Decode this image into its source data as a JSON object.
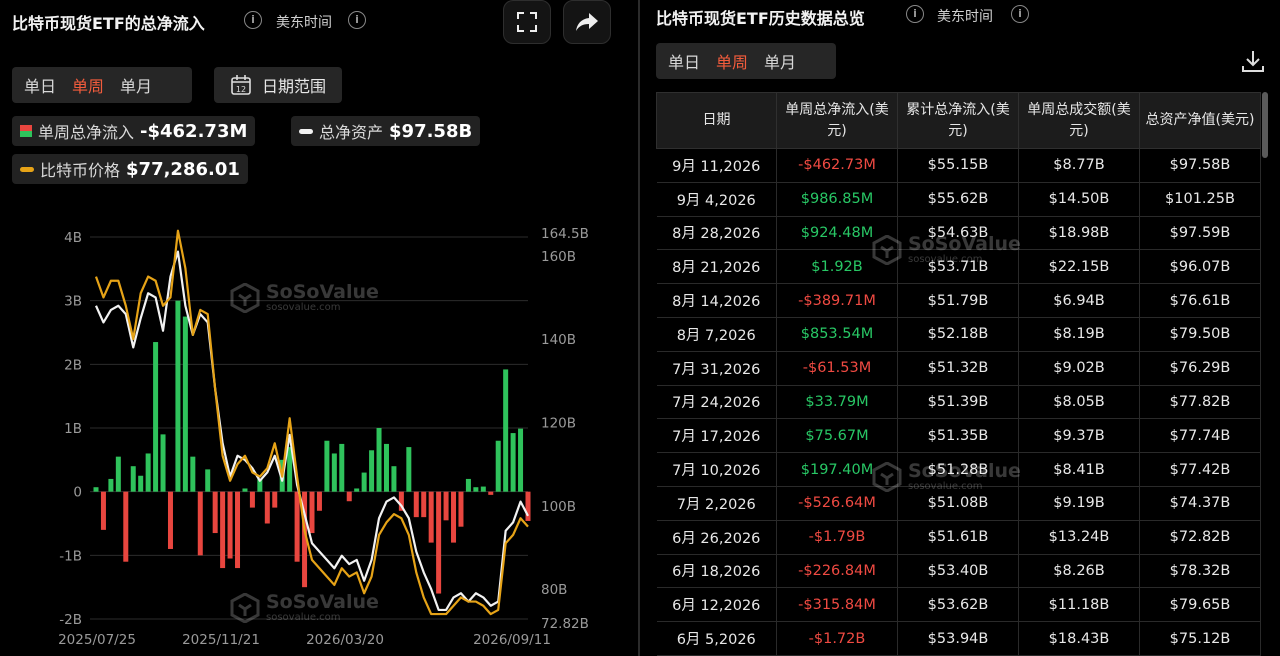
{
  "left": {
    "title": "比特币现货ETF的总净流入",
    "timezone": "美东时间",
    "tabs": [
      "单日",
      "单周",
      "单月"
    ],
    "active_tab": 1,
    "date_range_label": "日期范围",
    "date_icon_text": "12",
    "legend": {
      "flow_label": "单周总净流入",
      "flow_value": "-$462.73M",
      "assets_label": "总净资产",
      "assets_value": "$97.58B",
      "price_label": "比特币价格",
      "price_value": "$77,286.01"
    },
    "watermark": {
      "name": "SoSoValue",
      "url": "sosovalue.com"
    }
  },
  "right": {
    "title": "比特币现货ETF历史数据总览",
    "timezone": "美东时间",
    "tabs": [
      "单日",
      "单周",
      "单月"
    ],
    "active_tab": 1,
    "columns": [
      "日期",
      "单周总净流入(美元)",
      "累计总净流入(美元)",
      "单周总成交额(美元)",
      "总资产净值(美元)"
    ],
    "rows": [
      [
        "9月 11,2026",
        "-$462.73M",
        "$55.15B",
        "$8.77B",
        "$97.58B"
      ],
      [
        "9月 4,2026",
        "$986.85M",
        "$55.62B",
        "$14.50B",
        "$101.25B"
      ],
      [
        "8月 28,2026",
        "$924.48M",
        "$54.63B",
        "$18.98B",
        "$97.59B"
      ],
      [
        "8月 21,2026",
        "$1.92B",
        "$53.71B",
        "$22.15B",
        "$96.07B"
      ],
      [
        "8月 14,2026",
        "-$389.71M",
        "$51.79B",
        "$6.94B",
        "$76.61B"
      ],
      [
        "8月 7,2026",
        "$853.54M",
        "$52.18B",
        "$8.19B",
        "$79.50B"
      ],
      [
        "7月 31,2026",
        "-$61.53M",
        "$51.32B",
        "$9.02B",
        "$76.29B"
      ],
      [
        "7月 24,2026",
        "$33.79M",
        "$51.39B",
        "$8.05B",
        "$77.82B"
      ],
      [
        "7月 17,2026",
        "$75.67M",
        "$51.35B",
        "$9.37B",
        "$77.74B"
      ],
      [
        "7月 10,2026",
        "$197.40M",
        "$51.28B",
        "$8.41B",
        "$77.42B"
      ],
      [
        "7月 2,2026",
        "-$526.64M",
        "$51.08B",
        "$9.19B",
        "$74.37B"
      ],
      [
        "6月 26,2026",
        "-$1.79B",
        "$51.61B",
        "$13.24B",
        "$72.82B"
      ],
      [
        "6月 18,2026",
        "-$226.84M",
        "$53.40B",
        "$8.26B",
        "$78.32B"
      ],
      [
        "6月 12,2026",
        "-$315.84M",
        "$53.62B",
        "$11.18B",
        "$79.65B"
      ],
      [
        "6月 5,2026",
        "-$1.72B",
        "$53.94B",
        "$18.43B",
        "$75.12B"
      ]
    ]
  },
  "colors": {
    "inflow": "#2fc35c",
    "outflow": "#e8463f",
    "assets_line": "#f2f2f2",
    "price_line": "#e6a317",
    "active_tab": "#f25c3c"
  },
  "chart_data": {
    "type": "bar",
    "x_ticks": [
      "2025/07/25",
      "2025/11/21",
      "2026/03/20",
      "2026/09/11"
    ],
    "y_left_ticks": [
      "4B",
      "3B",
      "2B",
      "1B",
      "0",
      "-1B",
      "-2B"
    ],
    "y_left_range": [
      -2,
      4
    ],
    "y_right_ticks": [
      "164.5B",
      "160B",
      "140B",
      "120B",
      "100B",
      "80B",
      "72.82B"
    ],
    "y_right_range": [
      72.82,
      164.5
    ],
    "series": [
      {
        "name": "单周总净流入",
        "type": "bar",
        "unit": "B",
        "values": [
          0.07,
          -0.6,
          0.2,
          0.55,
          -1.1,
          0.4,
          0.25,
          0.6,
          2.35,
          0.9,
          -0.9,
          3.0,
          2.75,
          0.55,
          -1.0,
          0.35,
          -0.65,
          -1.2,
          -1.05,
          -1.2,
          0.05,
          -0.25,
          0.2,
          -0.5,
          -0.25,
          0.5,
          0.7,
          -1.1,
          -1.5,
          -0.65,
          -0.3,
          0.8,
          0.6,
          0.75,
          -0.15,
          0.05,
          0.3,
          0.65,
          1.0,
          0.75,
          0.4,
          -0.3,
          0.7,
          -0.4,
          -0.4,
          -0.8,
          -1.6,
          -0.45,
          -0.8,
          -0.55,
          0.2,
          0.07,
          0.08,
          -0.05,
          0.8,
          1.92,
          0.92,
          0.99,
          -0.46
        ]
      },
      {
        "name": "总净资产",
        "type": "line",
        "unit": "B",
        "values": [
          148,
          144,
          147,
          148,
          146,
          138,
          145,
          151,
          150,
          142,
          155,
          161,
          148,
          141,
          146,
          144,
          128,
          115,
          107,
          112,
          111,
          109,
          106,
          108,
          112,
          106,
          117,
          105,
          98,
          91,
          89,
          87,
          85,
          88,
          86,
          87,
          82,
          87,
          97,
          101,
          102,
          100,
          97,
          89,
          84,
          80,
          75,
          75,
          78,
          79,
          77,
          79,
          78,
          76,
          77,
          94,
          96,
          101,
          97.58
        ]
      },
      {
        "name": "比特币价格",
        "type": "line",
        "values": [
          155,
          150,
          154,
          154,
          148,
          140,
          151,
          155,
          154,
          148,
          150,
          166,
          157,
          141,
          147,
          146,
          128,
          112,
          106,
          110,
          112,
          108,
          107,
          109,
          115,
          107,
          121,
          107,
          94,
          87,
          85,
          83,
          81,
          85,
          83,
          84,
          79,
          83,
          93,
          96,
          98,
          97,
          93,
          84,
          78,
          74,
          74,
          74,
          76,
          78,
          77,
          77,
          76,
          74,
          75,
          91,
          93,
          97,
          95
        ]
      }
    ]
  }
}
